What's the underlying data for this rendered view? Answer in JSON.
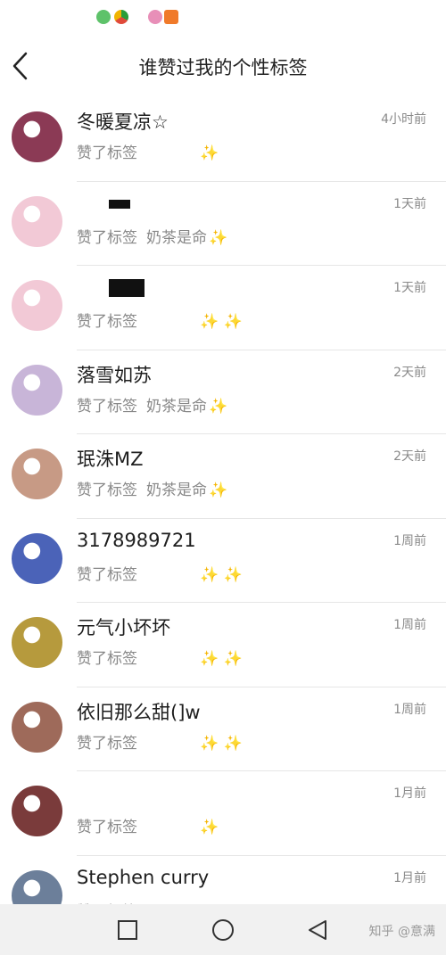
{
  "status_bar": {
    "icons": [
      "chat-app-icon",
      "browser-icon",
      "gallery-app-icon",
      "video-app-icon"
    ]
  },
  "header": {
    "title": "谁赞过我的个性标签"
  },
  "list": {
    "action_text": "赞了标签",
    "items": [
      {
        "name": "冬暖夏凉☆",
        "time": "4小时前",
        "tag": "",
        "sparkles": "✨",
        "name_redacted": false,
        "avatar_color": "#8b3a55"
      },
      {
        "name": "",
        "time": "1天前",
        "tag": "奶茶是命",
        "sparkles": "✨",
        "name_redacted": true,
        "avatar_color": "#f2c9d6"
      },
      {
        "name": "",
        "time": "1天前",
        "tag": "",
        "sparkles": "✨ ✨",
        "name_redacted": true,
        "avatar_color": "#f2c9d6"
      },
      {
        "name": "落雪如苏",
        "time": "2天前",
        "tag": "奶茶是命",
        "sparkles": "✨",
        "name_redacted": false,
        "avatar_color": "#c8b5d8"
      },
      {
        "name": "珉洙MZ",
        "time": "2天前",
        "tag": "奶茶是命",
        "sparkles": "✨",
        "name_redacted": false,
        "avatar_color": "#c79a85"
      },
      {
        "name": "3178989721",
        "time": "1周前",
        "tag": "",
        "sparkles": "✨ ✨",
        "name_redacted": false,
        "avatar_color": "#4b63b8"
      },
      {
        "name": "元气小坏坏",
        "time": "1周前",
        "tag": "",
        "sparkles": "✨ ✨",
        "name_redacted": false,
        "avatar_color": "#b69a3d"
      },
      {
        "name": "依旧那么甜(]w",
        "time": "1周前",
        "tag": "",
        "sparkles": "✨ ✨",
        "name_redacted": false,
        "avatar_color": "#9e6a5a"
      },
      {
        "name": "",
        "time": "1月前",
        "tag": "",
        "sparkles": "✨",
        "name_redacted": false,
        "avatar_color": "#7a3b3b"
      },
      {
        "name": "Stephen curry",
        "time": "1月前",
        "tag": "",
        "sparkles": "",
        "name_redacted": false,
        "avatar_color": "#6c7f9a"
      }
    ]
  },
  "nav_bar": {
    "buttons": [
      "recent-apps-button",
      "home-button",
      "back-nav-button"
    ]
  },
  "watermark": "知乎 @意满"
}
